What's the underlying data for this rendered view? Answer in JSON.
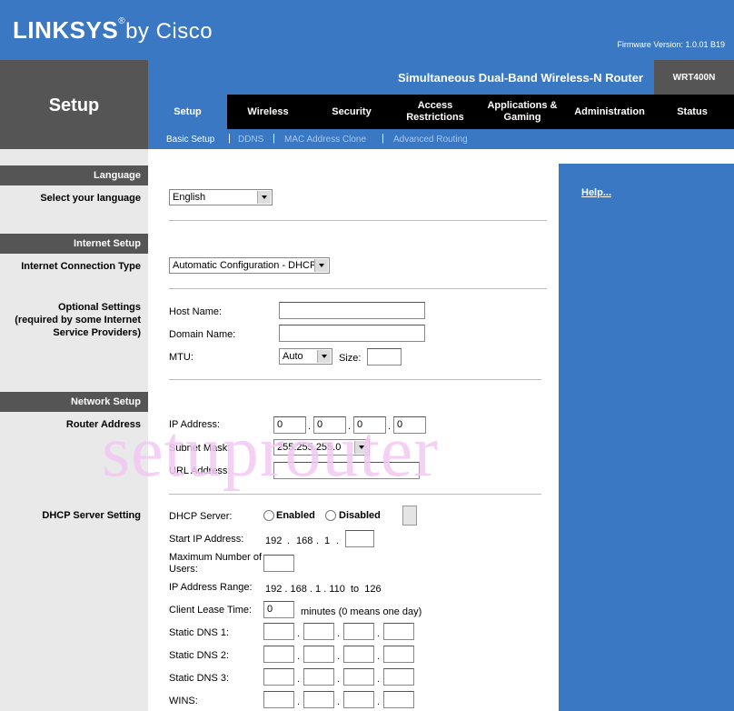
{
  "header": {
    "logo_main": "LINKSYS",
    "logo_reg": "®",
    "logo_by": "by Cisco",
    "firmware": "Firmware Version: 1.0.01 B19",
    "product": "Simultaneous Dual-Band Wireless-N Router",
    "model": "WRT400N",
    "section_title": "Setup"
  },
  "tabs": [
    {
      "label": "Setup"
    },
    {
      "label": "Wireless"
    },
    {
      "label": "Security"
    },
    {
      "label": "Access\nRestrictions"
    },
    {
      "label": "Applications &\nGaming"
    },
    {
      "label": "Administration"
    },
    {
      "label": "Status"
    }
  ],
  "subtabs": [
    "Basic Setup",
    "DDNS",
    "MAC Address Clone",
    "Advanced Routing"
  ],
  "subsep": "|",
  "left": {
    "language": "Language",
    "select_language": "Select your language",
    "internet_setup": "Internet Setup",
    "connection_type": "Internet Connection Type",
    "optional": "Optional Settings\n(required by some Internet\nService Providers)",
    "network_setup": "Network Setup",
    "router_address": "Router Address",
    "dhcp_setting": "DHCP Server Setting"
  },
  "help": "Help...",
  "language_value": "English",
  "connection_value": "Automatic Configuration - DHCP",
  "optional": {
    "host_label": "Host Name:",
    "domain_label": "Domain Name:",
    "mtu_label": "MTU:",
    "mtu_value": "Auto",
    "size_label": "Size:"
  },
  "router": {
    "ip_label": "IP Address:",
    "ip": [
      "0",
      "0",
      "0",
      "0"
    ],
    "mask_label": "Subnet Mask:",
    "mask_value": "255.255.255.0",
    "url_label": "URL Address:"
  },
  "dhcp": {
    "server_label": "DHCP Server:",
    "enabled": "Enabled",
    "disabled": "Disabled",
    "start_label": "Start IP Address:",
    "start_prefix": [
      "192",
      "168",
      "1"
    ],
    "max_label": "Maximum Number of\nUsers:",
    "range_label": "IP Address Range:",
    "range_value": "192 . 168 . 1 . 110  to  126",
    "lease_label": "Client Lease Time:",
    "lease_value": "0",
    "lease_suffix": "minutes (0 means one day)",
    "dns1": "Static DNS 1:",
    "dns2": "Static DNS 2:",
    "dns3": "Static DNS 3:",
    "wins": "WINS:"
  },
  "watermark": "setuprouter"
}
